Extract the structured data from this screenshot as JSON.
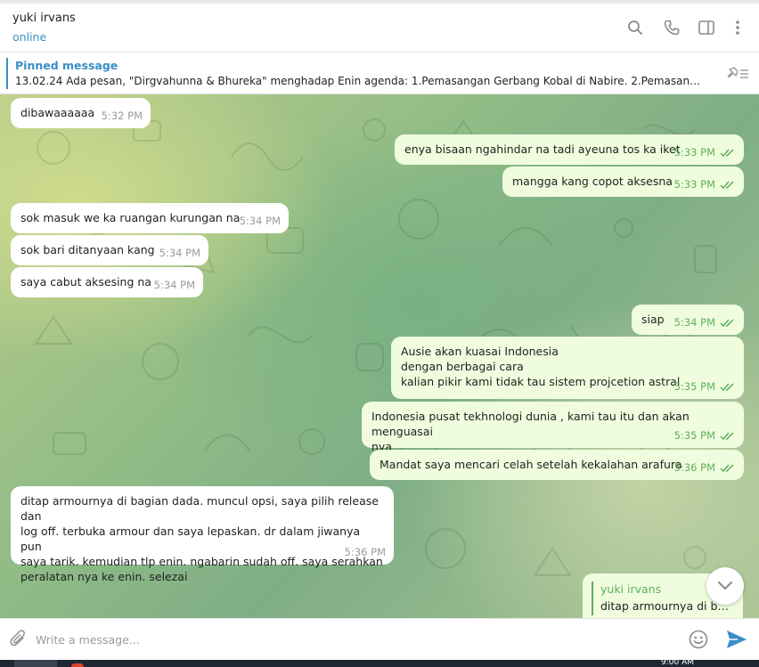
{
  "header": {
    "name": "yuki irvans",
    "status": "online",
    "icons": [
      "search-icon",
      "phone-icon",
      "sidebar-toggle-icon",
      "more-vertical-icon"
    ]
  },
  "pinned": {
    "title": "Pinned message",
    "text": "13.02.24 Ada pesan, \"Dirgvahunna & Bhureka\" menghadap Enin agenda: 1.Pemasangan Gerbang Kobal di Nabire. 2.Pemasangan ...",
    "icon": "unpin-icon"
  },
  "messages": [
    {
      "dir": "in",
      "text": "dibawaaaaaa",
      "time": "5:32 PM"
    },
    {
      "dir": "out",
      "text": "enya bisaan ngahindar na tadi ayeuna tos ka iket",
      "time": "5:33 PM"
    },
    {
      "dir": "out",
      "text": "mangga kang copot aksesna",
      "time": "5:33 PM"
    },
    {
      "dir": "in",
      "text": "sok masuk we ka ruangan kurungan na",
      "time": "5:34 PM"
    },
    {
      "dir": "in",
      "text": "sok bari ditanyaan kang",
      "time": "5:34 PM"
    },
    {
      "dir": "in",
      "text": "saya cabut aksesing na",
      "time": "5:34 PM"
    },
    {
      "dir": "out",
      "text": "siap",
      "time": "5:34 PM"
    },
    {
      "dir": "out",
      "text": "Ausie akan kuasai Indonesia\ndengan berbagai cara\nkalian pikir kami tidak tau sistem projcetion astral",
      "time": "5:35 PM"
    },
    {
      "dir": "out",
      "text": "Indonesia pusat tekhnologi dunia , kami tau itu dan akan menguasai\nnya",
      "time": "5:35 PM"
    },
    {
      "dir": "out",
      "text": "Mandat saya mencari celah setelah kekalahan arafura",
      "time": "5:36 PM"
    },
    {
      "dir": "in",
      "text": "ditap armournya di bagian dada. muncul opsi, saya pilih release dan\nlog off. terbuka armour dan saya lepaskan. dr dalam jiwanya pun\nsaya tarik. kemudian tlp enin. ngabarin sudah off. saya serahkan\nperalatan nya ke enin. selezai",
      "time": "5:36 PM"
    }
  ],
  "reply_preview": {
    "name": "yuki irvans",
    "text": "ditap armournya di ba..."
  },
  "composer": {
    "placeholder": "Write a message...",
    "icons": [
      "attach-icon",
      "emoji-icon",
      "send-icon"
    ]
  },
  "taskbar": {
    "clock": "9:00 AM"
  },
  "colors": {
    "accent": "#3a8fc6",
    "outgoing_bubble": "#effdde",
    "incoming_bubble": "#ffffff",
    "read_ticks": "#5fae5a"
  }
}
